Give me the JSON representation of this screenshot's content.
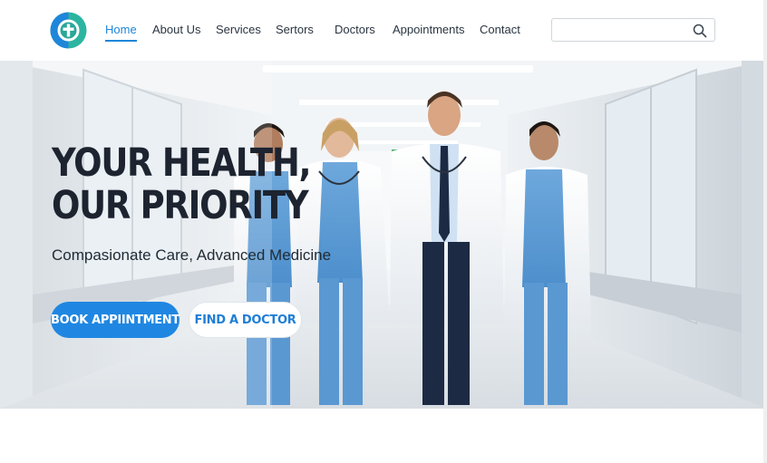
{
  "header": {
    "logo_icon": "medical-cross-logo-icon",
    "nav": [
      {
        "label": "Home",
        "active": true
      },
      {
        "label": "About Us",
        "active": false
      },
      {
        "label": "Services",
        "active": false
      },
      {
        "label": "Sertors",
        "active": false
      },
      {
        "label": "Doctors",
        "active": false
      },
      {
        "label": "Appointments",
        "active": false
      },
      {
        "label": "Contact",
        "active": false
      }
    ],
    "search": {
      "placeholder": "",
      "value": "",
      "icon": "search-icon"
    }
  },
  "hero": {
    "title_line1": "YOUR HEALTH,",
    "title_line2": "OUR PRIORITY",
    "subtitle": "Compasionate Care, Advanced Medicine",
    "primary_button": "BOOK APPIINTMENT",
    "secondary_button": "FIND A DOCTOR",
    "image": "hospital-corridor-medical-staff-photo"
  },
  "colors": {
    "accent": "#1f87e2",
    "logo_teal": "#2bb5a0",
    "logo_blue": "#1f86d9",
    "text_dark": "#1d2430"
  }
}
